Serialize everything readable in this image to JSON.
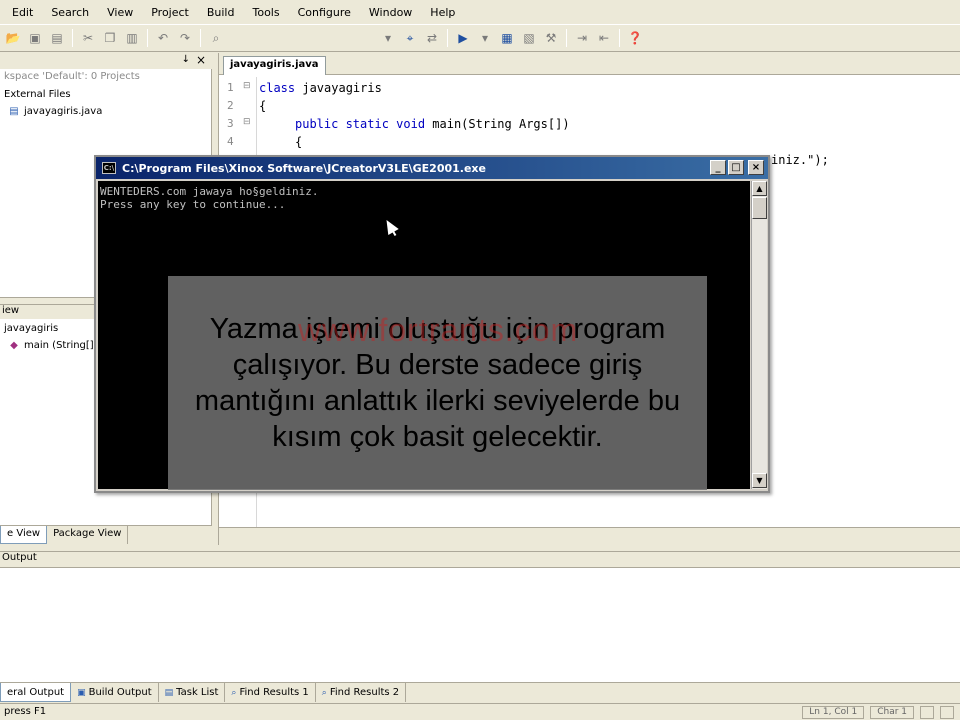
{
  "menu": [
    "Edit",
    "Search",
    "View",
    "Project",
    "Build",
    "Tools",
    "Configure",
    "Window",
    "Help"
  ],
  "workspace": {
    "caption": "kspace 'Default': 0 Projects",
    "external_files": "External Files",
    "file": "javayagiris.java",
    "view_header": "iew",
    "class_item": "javayagiris",
    "method_item": "main (String[],",
    "tabs": [
      "e View",
      "Package View"
    ]
  },
  "editor": {
    "tab": "javayagiris.java",
    "line_numbers": [
      "1",
      "2",
      "3",
      "4"
    ],
    "line1_kw": "class",
    "line1_rest": " javayagiris",
    "line2": "{",
    "line3_kw": "public static void",
    "line3_rest": " main(String Args[])",
    "line4": "{",
    "line5_tail": "iniz.\");"
  },
  "console": {
    "title": "C:\\Program Files\\Xinox Software\\JCreatorV3LE\\GE2001.exe",
    "line1": "WENTEDERS.com jawaya ho§geldiniz.",
    "line2": "Press any key to continue..."
  },
  "subtitle": "Yazma işlemi oluştuğu için program çalışıyor. Bu derste sadece giriş mantığını anlattık ilerki seviyelerde bu kısım çok basit gelecektir.",
  "watermark": "www.fortrants.com",
  "output": {
    "header": "Output",
    "tabs": [
      "eral Output",
      "Build Output",
      "Task List",
      "Find Results 1",
      "Find Results 2"
    ]
  },
  "status": {
    "left": "press F1",
    "cells": [
      "Ln 1, Col 1",
      "Char 1",
      "",
      ""
    ]
  }
}
